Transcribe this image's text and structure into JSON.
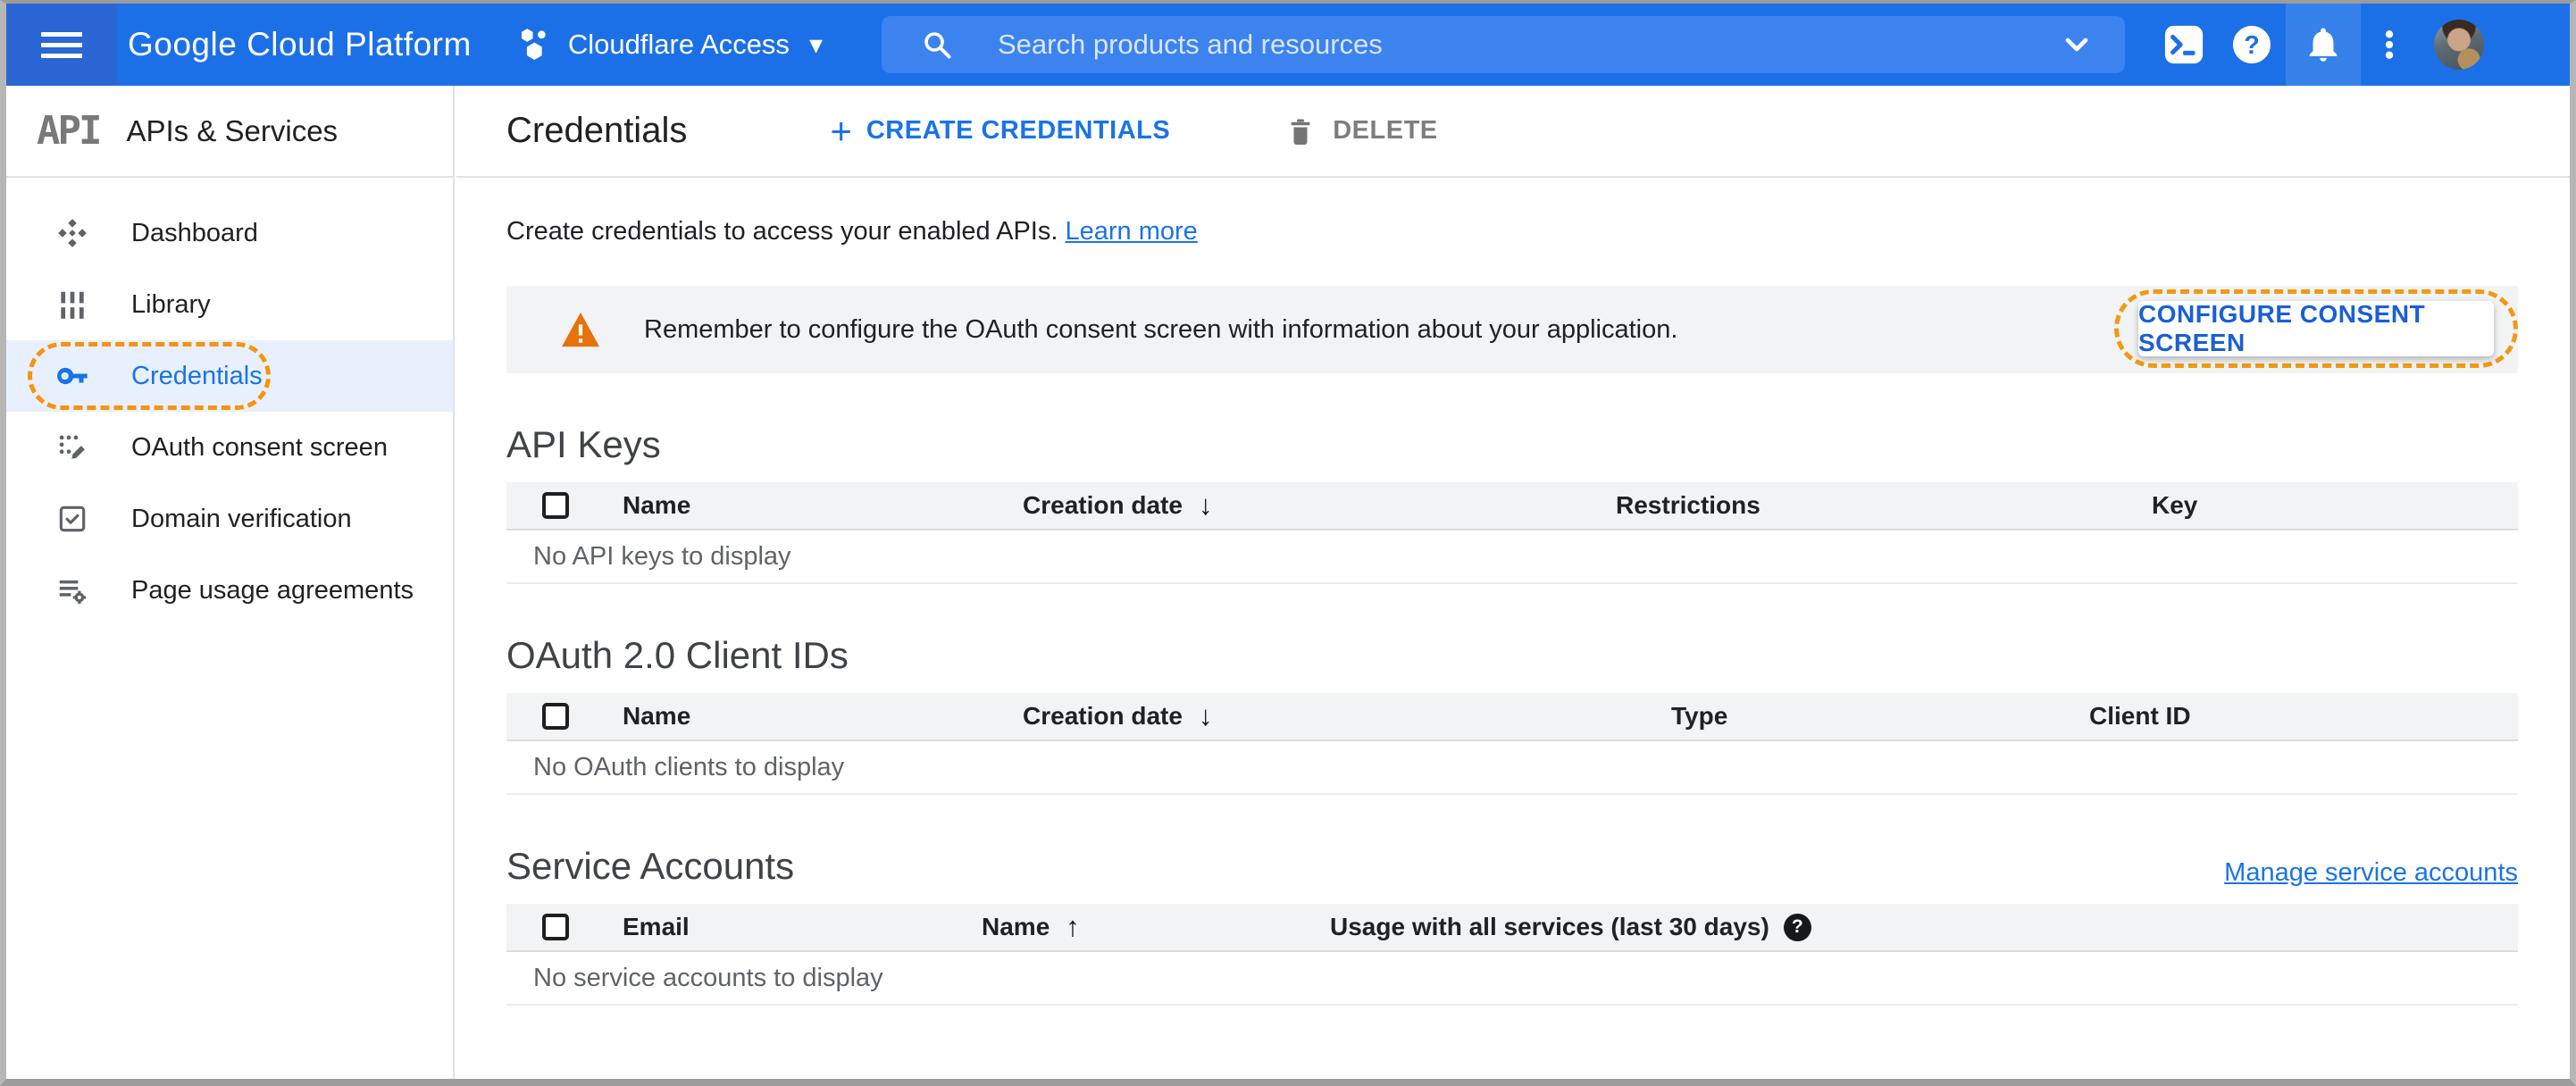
{
  "topbar": {
    "logo": "Google Cloud Platform",
    "project": "Cloudflare Access",
    "search_placeholder": "Search products and resources"
  },
  "sidebar": {
    "logo": "API",
    "title": "APIs & Services",
    "items": [
      {
        "label": "Dashboard",
        "active": false
      },
      {
        "label": "Library",
        "active": false
      },
      {
        "label": "Credentials",
        "active": true
      },
      {
        "label": "OAuth consent screen",
        "active": false
      },
      {
        "label": "Domain verification",
        "active": false
      },
      {
        "label": "Page usage agreements",
        "active": false
      }
    ]
  },
  "page": {
    "title": "Credentials",
    "create_button": "CREATE CREDENTIALS",
    "delete_button": "DELETE",
    "intro": "Create credentials to access your enabled APIs.",
    "learn_more": "Learn more",
    "banner": {
      "message": "Remember to configure the OAuth consent screen with information about your application.",
      "button": "CONFIGURE CONSENT SCREEN"
    }
  },
  "tables": {
    "api_keys": {
      "title": "API Keys",
      "col_name": "Name",
      "col_creation": "Creation date",
      "col_restrictions": "Restrictions",
      "col_key": "Key",
      "sort_column": "Creation date",
      "sort_direction": "desc",
      "empty": "No API keys to display",
      "rows": []
    },
    "oauth": {
      "title": "OAuth 2.0 Client IDs",
      "col_name": "Name",
      "col_creation": "Creation date",
      "col_type": "Type",
      "col_client_id": "Client ID",
      "sort_column": "Creation date",
      "sort_direction": "desc",
      "empty": "No OAuth clients to display",
      "rows": []
    },
    "service_accounts": {
      "title": "Service Accounts",
      "manage_link": "Manage service accounts",
      "col_email": "Email",
      "col_name": "Name",
      "col_usage": "Usage with all services (last 30 days)",
      "sort_column": "Name",
      "sort_direction": "asc",
      "empty": "No service accounts to display",
      "rows": []
    }
  },
  "icons": {
    "sort_desc": "↓",
    "sort_asc": "↑",
    "help_mark": "?",
    "dropdown_triangle": "▾",
    "plus": "+"
  },
  "colors": {
    "topbar_blue": "#1b70e8",
    "topbar_dark_blue": "#2a67d4",
    "search_pill_blue": "#3c83f0",
    "accent_blue": "#1a73e8",
    "active_item_bg": "#e8f0fe",
    "annotation_orange": "#f29913",
    "warning_orange": "#e8710a",
    "banner_bg": "#f1f3f4",
    "table_header_bg": "#f1f3f4"
  }
}
